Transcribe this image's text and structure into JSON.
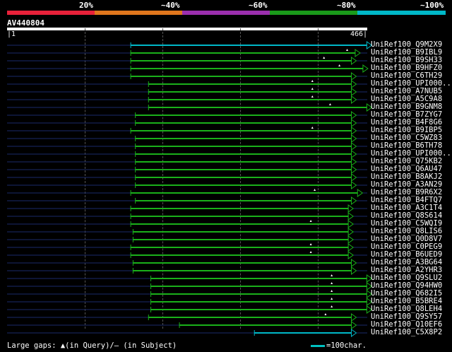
{
  "legend": {
    "segments": [
      {
        "color": "#e8213a"
      },
      {
        "color": "#e0761d"
      },
      {
        "color": "#9b2fae"
      },
      {
        "color": "#1a9a1a"
      },
      {
        "color": "#00b8c8"
      }
    ],
    "labels": [
      "20%",
      "~40%",
      "~60%",
      "~80%",
      "~100%"
    ]
  },
  "query": {
    "id": "AV440804",
    "start_label": "|1",
    "end_label": "466|",
    "length": 466
  },
  "colors": {
    "hit": "#1ab01a",
    "best": "#00b8c8",
    "gap": "#ffffff",
    "background": "#000000"
  },
  "hits": [
    {
      "id": "UniRef100_Q9M2X9",
      "start": 160,
      "end": 470,
      "color": "best",
      "gap": null
    },
    {
      "id": "UniRef100_B9IBL9",
      "start": 160,
      "end": 455,
      "color": "hit",
      "gap": 440
    },
    {
      "id": "UniRef100_B9SH33",
      "start": 160,
      "end": 450,
      "color": "hit",
      "gap": 410
    },
    {
      "id": "UniRef100_B9HFZ0",
      "start": 160,
      "end": 465,
      "color": "hit",
      "gap": 430
    },
    {
      "id": "UniRef100_C6TH29",
      "start": 160,
      "end": 450,
      "color": "hit",
      "gap": null
    },
    {
      "id": "UniRef100_UPI000..",
      "start": 183,
      "end": 450,
      "color": "hit",
      "gap": 395
    },
    {
      "id": "UniRef100_A7NUB5",
      "start": 183,
      "end": 450,
      "color": "hit",
      "gap": 395
    },
    {
      "id": "UniRef100_A5C9A8",
      "start": 183,
      "end": 450,
      "color": "hit",
      "gap": 395
    },
    {
      "id": "UniRef100_B9GNM8",
      "start": 183,
      "end": 470,
      "color": "hit",
      "gap": 418
    },
    {
      "id": "UniRef100_B7ZYG7",
      "start": 166,
      "end": 450,
      "color": "hit",
      "gap": null
    },
    {
      "id": "UniRef100_B4F8G6",
      "start": 166,
      "end": 450,
      "color": "hit",
      "gap": null
    },
    {
      "id": "UniRef100_B9IBP5",
      "start": 160,
      "end": 450,
      "color": "hit",
      "gap": 395
    },
    {
      "id": "UniRef100_C5WZ83",
      "start": 166,
      "end": 450,
      "color": "hit",
      "gap": null
    },
    {
      "id": "UniRef100_B6TH78",
      "start": 166,
      "end": 450,
      "color": "hit",
      "gap": null
    },
    {
      "id": "UniRef100_UPI000..",
      "start": 166,
      "end": 450,
      "color": "hit",
      "gap": null
    },
    {
      "id": "UniRef100_Q75KB2",
      "start": 166,
      "end": 450,
      "color": "hit",
      "gap": null
    },
    {
      "id": "UniRef100_Q6AU47",
      "start": 166,
      "end": 450,
      "color": "hit",
      "gap": null
    },
    {
      "id": "UniRef100_B8AKJ2",
      "start": 166,
      "end": 450,
      "color": "hit",
      "gap": null
    },
    {
      "id": "UniRef100_A3AN29",
      "start": 166,
      "end": 450,
      "color": "hit",
      "gap": null
    },
    {
      "id": "UniRef100_B9R6X2",
      "start": 160,
      "end": 458,
      "color": "hit",
      "gap": 398
    },
    {
      "id": "UniRef100_B4FTQ7",
      "start": 166,
      "end": 450,
      "color": "hit",
      "gap": null
    },
    {
      "id": "UniRef100_A3C1T4",
      "start": 160,
      "end": 446,
      "color": "hit",
      "gap": null
    },
    {
      "id": "UniRef100_Q8S614",
      "start": 160,
      "end": 446,
      "color": "hit",
      "gap": null
    },
    {
      "id": "UniRef100_C5WQI9",
      "start": 160,
      "end": 446,
      "color": "hit",
      "gap": 393
    },
    {
      "id": "UniRef100_Q8LIS6",
      "start": 163,
      "end": 446,
      "color": "hit",
      "gap": null
    },
    {
      "id": "UniRef100_Q0D8V7",
      "start": 163,
      "end": 446,
      "color": "hit",
      "gap": null
    },
    {
      "id": "UniRef100_C0PEG9",
      "start": 160,
      "end": 446,
      "color": "hit",
      "gap": 393
    },
    {
      "id": "UniRef100_B6UED9",
      "start": 160,
      "end": 446,
      "color": "hit",
      "gap": 393
    },
    {
      "id": "UniRef100_A3BG64",
      "start": 163,
      "end": 450,
      "color": "hit",
      "gap": null
    },
    {
      "id": "UniRef100_A2YHR3",
      "start": 163,
      "end": 450,
      "color": "hit",
      "gap": null
    },
    {
      "id": "UniRef100_Q9SLU2",
      "start": 186,
      "end": 470,
      "color": "hit",
      "gap": 420
    },
    {
      "id": "UniRef100_Q94HW0",
      "start": 186,
      "end": 470,
      "color": "hit",
      "gap": 420
    },
    {
      "id": "UniRef100_Q682I5",
      "start": 186,
      "end": 470,
      "color": "hit",
      "gap": 420
    },
    {
      "id": "UniRef100_B5BRE4",
      "start": 186,
      "end": 470,
      "color": "hit",
      "gap": 420
    },
    {
      "id": "UniRef100_Q8LEH4",
      "start": 186,
      "end": 470,
      "color": "hit",
      "gap": 420
    },
    {
      "id": "UniRef100_Q9SY57",
      "start": 183,
      "end": 450,
      "color": "hit",
      "gap": 412
    },
    {
      "id": "UniRef100_Q10EF6",
      "start": 223,
      "end": 450,
      "color": "hit",
      "gap": null
    },
    {
      "id": "UniRef100_C5X8P2",
      "start": 320,
      "end": 450,
      "color": "best",
      "gap": null
    }
  ],
  "footer": {
    "left": "Large gaps: ▲(in Query)/— (in Subject)",
    "right": "=100char."
  }
}
